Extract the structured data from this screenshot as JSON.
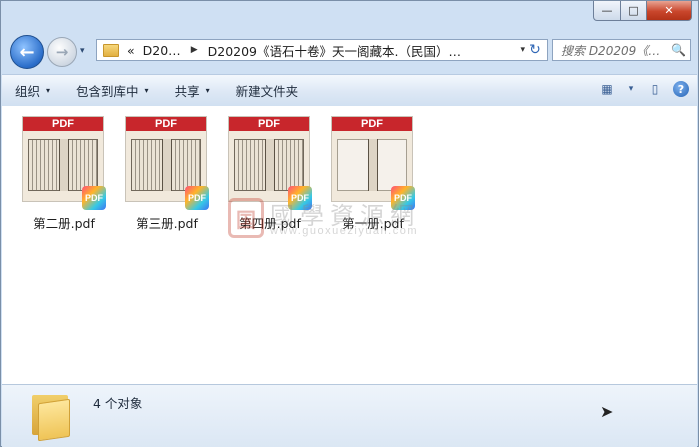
{
  "window": {
    "caption": {
      "minimize": "—",
      "maximize": "□",
      "close": "✕"
    }
  },
  "nav": {
    "back_icon": "arrow-left-icon",
    "forward_icon": "arrow-right-icon",
    "recent_icon": "▾",
    "address": {
      "overflow": "«",
      "crumb1": "D20…",
      "sep": "▶",
      "crumb2": "D20209《语石十卷》天一阁藏本.（民国）…",
      "dropdown": "▾"
    },
    "refresh": "↻",
    "search_placeholder": "搜索 D20209《…",
    "search_icon": "🔍"
  },
  "toolbar": {
    "items": [
      {
        "label": "组织",
        "arrow": "▾"
      },
      {
        "label": "包含到库中",
        "arrow": "▾"
      },
      {
        "label": "共享",
        "arrow": "▾"
      },
      {
        "label": "新建文件夹",
        "arrow": ""
      }
    ],
    "view_icon": "▦",
    "view_arrow": "▾",
    "pane_icon": "▯",
    "help": "?"
  },
  "files": [
    {
      "name": "第二册.pdf",
      "band": "PDF",
      "badge": "PDF"
    },
    {
      "name": "第三册.pdf",
      "band": "PDF",
      "badge": "PDF"
    },
    {
      "name": "第四册.pdf",
      "band": "PDF",
      "badge": "PDF"
    },
    {
      "name": "第一册.pdf",
      "band": "PDF",
      "badge": "PDF"
    }
  ],
  "watermark": {
    "seal": "国",
    "text": "國學資源網",
    "url": "www.guoxueziyuan.com"
  },
  "status": {
    "count": "4 个对象"
  }
}
